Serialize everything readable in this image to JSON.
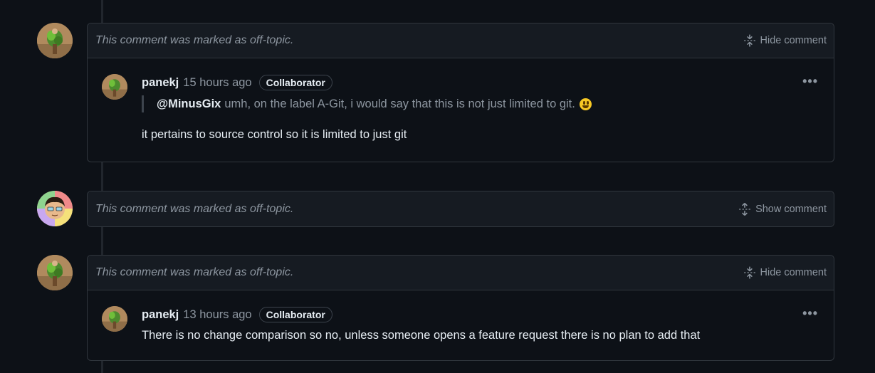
{
  "comments": [
    {
      "state": "expanded",
      "header_text": "This comment was marked as off-topic.",
      "toggle_label": "Hide comment",
      "author": "panekj",
      "time": "15 hours ago",
      "badge": "Collaborator",
      "quote_mention": "@MinusGix",
      "quote_text": "umh, on the label A-Git, i would say that this is not just limited to git.",
      "body": "it pertains to source control so it is limited to just git"
    },
    {
      "state": "collapsed",
      "header_text": "This comment was marked as off-topic.",
      "toggle_label": "Show comment"
    },
    {
      "state": "expanded",
      "header_text": "This comment was marked as off-topic.",
      "toggle_label": "Hide comment",
      "author": "panekj",
      "time": "13 hours ago",
      "badge": "Collaborator",
      "body": "There is no change comparison so no, unless someone opens a feature request there is no plan to add that"
    }
  ],
  "icons": {
    "avatar_1": "avatar-plant-icon",
    "avatar_2": "avatar-cartoon-icon",
    "collapse": "fold-icon",
    "expand": "unfold-icon",
    "kebab": "kebab-horizontal-icon",
    "emoji": "smiley-emoji-icon"
  },
  "colors": {
    "background": "#0d1117",
    "header_bg": "#161b22",
    "border": "#30363d",
    "muted": "#8d96a0",
    "text": "#e6edf3"
  }
}
